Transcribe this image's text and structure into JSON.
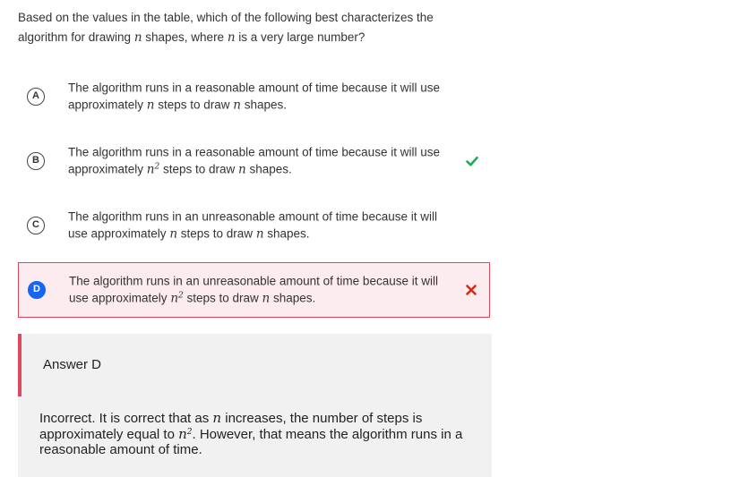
{
  "question": {
    "part1": "Based on the values in the table, which of the following best characterizes the algorithm for drawing ",
    "var1": "n",
    "part2": " shapes, where ",
    "var2": "n",
    "part3": " is a very large number?"
  },
  "options": [
    {
      "letter": "A",
      "text_before": "The algorithm runs in a reasonable amount of time because it will use approximately ",
      "steps_var": "n",
      "steps_exp": "",
      "text_mid": " steps to draw ",
      "shapes_var": "n",
      "text_after": " shapes.",
      "status": "none"
    },
    {
      "letter": "B",
      "text_before": "The algorithm runs in a reasonable amount of time because it will use approximately ",
      "steps_var": "n",
      "steps_exp": "2",
      "text_mid": " steps to draw ",
      "shapes_var": "n",
      "text_after": " shapes.",
      "status": "correct",
      "status_icon": "checkmark-icon",
      "status_color": "#1fab54"
    },
    {
      "letter": "C",
      "text_before": "The algorithm runs in an unreasonable amount of time because it will use approximately ",
      "steps_var": "n",
      "steps_exp": "",
      "text_mid": " steps to draw ",
      "shapes_var": "n",
      "text_after": " shapes.",
      "status": "none"
    },
    {
      "letter": "D",
      "text_before": "The algorithm runs in an unreasonable amount of time because it will use approximately ",
      "steps_var": "n",
      "steps_exp": "2",
      "text_mid": " steps to draw ",
      "shapes_var": "n",
      "text_after": " shapes.",
      "status": "incorrect-selected",
      "status_icon": "x-mark-icon",
      "status_color": "#d92916"
    }
  ],
  "explanation": {
    "title": "Answer D",
    "part1": "Incorrect. It is correct that as ",
    "var1": "n",
    "part2": " increases, the number of steps is approximately equal to ",
    "var2": "n",
    "exp2": "2",
    "part3": ". However, that means the algorithm runs in a reasonable amount of time.",
    "accent_color": "#e0485e"
  },
  "colors": {
    "selected_fill": "#1865f2",
    "wrong_background": "#fdecef",
    "wrong_border": "#e0485e",
    "correct": "#1fab54",
    "incorrect": "#d92916"
  }
}
